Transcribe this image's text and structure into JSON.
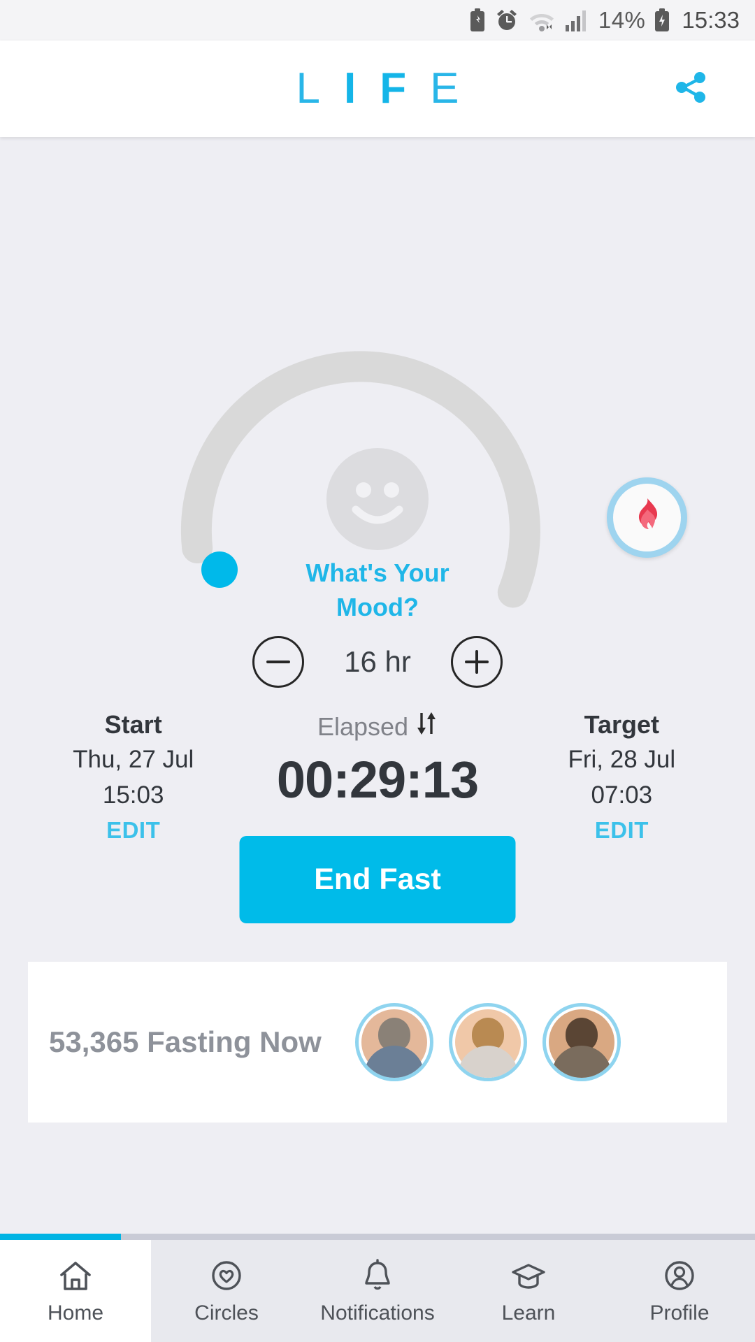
{
  "status_bar": {
    "icons": [
      "battery-saver-icon",
      "alarm-clock-icon",
      "wifi-icon",
      "signal-bars-icon"
    ],
    "battery_percent": "14%",
    "battery_icon": "battery-charging-icon",
    "clock": "15:33"
  },
  "header": {
    "logo_letters": [
      {
        "char": "L",
        "weight": "thin"
      },
      {
        "char": "I",
        "weight": "bold"
      },
      {
        "char": "F",
        "weight": "bold"
      },
      {
        "char": "E",
        "weight": "thin"
      }
    ],
    "share_icon": "share-icon",
    "accent_color": "#29b6e8"
  },
  "fast_ring": {
    "track_color": "#d9d9d9",
    "start_dot_color": "#00b9ea",
    "flame_icon": "flame-icon",
    "flame_color": "#e8394f",
    "flame_ring_color": "#9ed4ef"
  },
  "mood": {
    "icon": "smiley-face-icon",
    "line1": "What's Your",
    "line2": "Mood?",
    "color": "#1fb6e8"
  },
  "duration": {
    "decrease_label": "minus-icon",
    "increase_label": "plus-icon",
    "value": "16 hr"
  },
  "start": {
    "title": "Start",
    "date": "Thu, 27 Jul",
    "time": "15:03",
    "edit_label": "EDIT"
  },
  "elapsed": {
    "label": "Elapsed",
    "toggle_icon": "swap-arrows-icon",
    "value": "00:29:13"
  },
  "target": {
    "title": "Target",
    "date": "Fri, 28 Jul",
    "time": "07:03",
    "edit_label": "EDIT"
  },
  "primary_action": {
    "label": "End Fast",
    "color": "#00bbe9"
  },
  "community": {
    "title": "53,365 Fasting Now",
    "avatars": [
      {
        "name": "avatar-1",
        "skin": "#e4b89a",
        "hair": "#8a8177",
        "shirt": "#6b7f96"
      },
      {
        "name": "avatar-2",
        "skin": "#f0c8a8",
        "hair": "#b98a52",
        "shirt": "#d8d2cc"
      },
      {
        "name": "avatar-3",
        "skin": "#d9a882",
        "hair": "#5a4534",
        "shirt": "#7a6c5d"
      }
    ]
  },
  "bottom_nav": {
    "active_index": 0,
    "items": [
      {
        "label": "Home",
        "icon": "home-icon"
      },
      {
        "label": "Circles",
        "icon": "heart-circle-icon"
      },
      {
        "label": "Notifications",
        "icon": "bell-icon"
      },
      {
        "label": "Learn",
        "icon": "graduation-cap-icon"
      },
      {
        "label": "Profile",
        "icon": "user-circle-icon"
      }
    ]
  }
}
